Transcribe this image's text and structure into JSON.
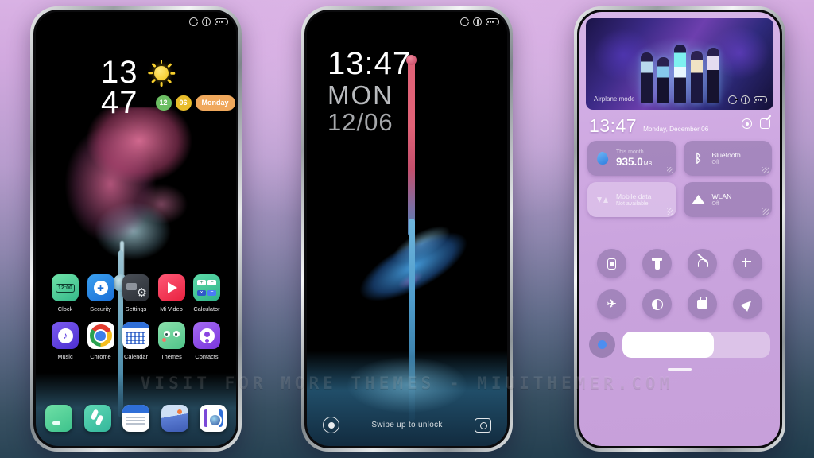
{
  "watermark": "VISIT FOR MORE THEMES - MIUITHEMER.COM",
  "theme": {
    "accent_green": "#6cbe63",
    "accent_yellow": "#e8bc2a",
    "accent_orange": "#f0a85c",
    "accent_blue": "#4d8ef0",
    "bg_top": "#d9b2e4",
    "bg_bottom": "#203c4c"
  },
  "phone1": {
    "name": "Home screen",
    "status_icons": [
      "signal-icon",
      "notification-icon",
      "battery-icon"
    ],
    "widget": {
      "hour": "13",
      "minute": "47",
      "weather_icon": "sun-icon",
      "badges": [
        {
          "label": "12",
          "color": "green"
        },
        {
          "label": "06",
          "color": "yellow"
        },
        {
          "label": "Monday",
          "color": "orange"
        }
      ]
    },
    "apps_row1": [
      {
        "label": "Clock",
        "icon": "clock-icon"
      },
      {
        "label": "Security",
        "icon": "security-icon"
      },
      {
        "label": "Settings",
        "icon": "settings-icon"
      },
      {
        "label": "Mi Video",
        "icon": "video-icon"
      },
      {
        "label": "Calculator",
        "icon": "calculator-icon"
      }
    ],
    "apps_row2": [
      {
        "label": "Music",
        "icon": "music-icon"
      },
      {
        "label": "Chrome",
        "icon": "chrome-icon"
      },
      {
        "label": "Calendar",
        "icon": "calendar-icon"
      },
      {
        "label": "Themes",
        "icon": "themes-icon"
      },
      {
        "label": "Contacts",
        "icon": "contacts-icon"
      }
    ],
    "dock": [
      {
        "name": "phone-icon"
      },
      {
        "name": "messages-icon"
      },
      {
        "name": "file-manager-icon"
      },
      {
        "name": "gallery-icon"
      },
      {
        "name": "camera-icon"
      }
    ]
  },
  "phone2": {
    "name": "Lock screen",
    "time": "13:47",
    "weekday": "MON",
    "date": "12/06",
    "hint": "Swipe up to unlock",
    "left_shortcut": "flashlight-icon",
    "right_shortcut": "camera-icon"
  },
  "phone3": {
    "name": "Control center",
    "media_label": "Airplane mode",
    "time": "13:47",
    "date": "Monday, December 06",
    "actions": [
      "settings-gear-icon",
      "edit-icon"
    ],
    "cards": [
      {
        "title": "This month",
        "value": "935.0",
        "unit": "MB",
        "icon": "data-usage-icon",
        "muted": false
      },
      {
        "title": "Bluetooth",
        "sub": "Off",
        "icon": "bluetooth-icon",
        "muted": false
      },
      {
        "title": "Mobile data",
        "sub": "Not available",
        "icon": "mobile-data-icon",
        "muted": true
      },
      {
        "title": "WLAN",
        "sub": "Off",
        "icon": "wifi-icon",
        "muted": false
      }
    ],
    "toggles": [
      {
        "name": "rotation-lock-icon"
      },
      {
        "name": "flashlight-icon"
      },
      {
        "name": "silent-mode-icon"
      },
      {
        "name": "screenshot-icon"
      },
      {
        "name": "airplane-mode-icon"
      },
      {
        "name": "dark-mode-icon"
      },
      {
        "name": "work-mode-icon"
      },
      {
        "name": "location-icon"
      }
    ],
    "brightness_percent": 62
  }
}
